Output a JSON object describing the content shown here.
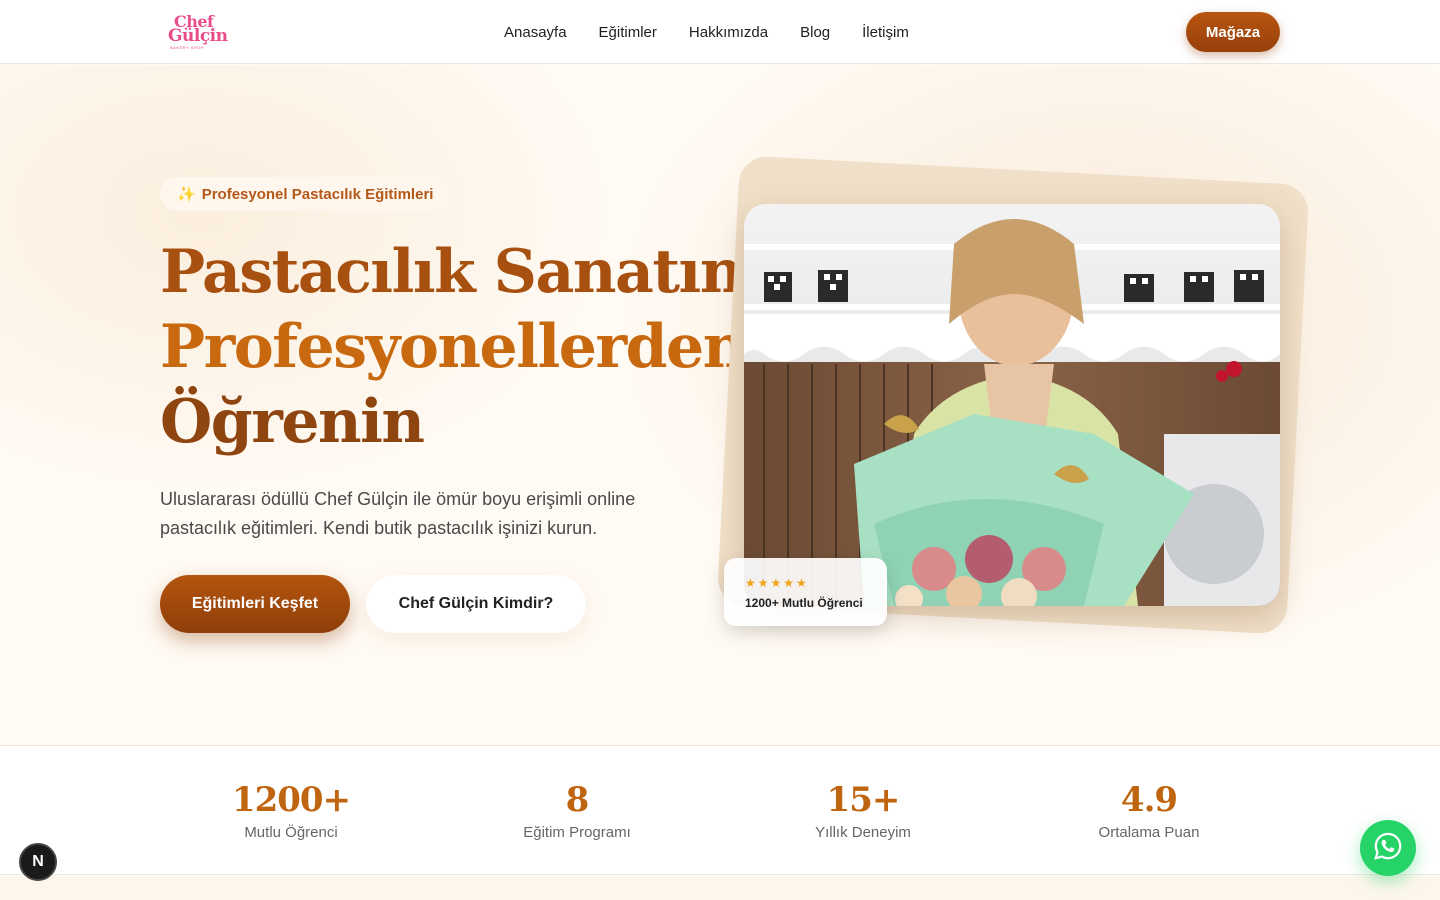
{
  "header": {
    "logo": {
      "line1": "Chef",
      "line2": "Gülçin",
      "line3": "BAKERY SHOP"
    },
    "nav": [
      "Anasayfa",
      "Eğitimler",
      "Hakkımızda",
      "Blog",
      "İletişim"
    ],
    "shop_label": "Mağaza"
  },
  "hero": {
    "badge_icon": "sparkles-icon",
    "badge": "Profesyonel Pastacılık Eğitimleri",
    "title_line1": "Pastacılık Sanatını",
    "title_line2": "Profesyonellerden",
    "title_line3": "Öğrenin",
    "lead": "Uluslararası ödüllü Chef Gülçin ile ömür boyu erişimli online pastacılık eğitimleri. Kendi butik pastacılık işinizi kurun.",
    "primary_cta": "Eğitimleri Keşfet",
    "secondary_cta": "Chef Gülçin Kimdir?",
    "rating_stars": "★★★★★",
    "rating_text": "1200+ Mutlu Öğrenci",
    "colors": {
      "brand": "#a8500f",
      "accent": "#c8690f",
      "dark": "#8e4510"
    }
  },
  "stats": [
    {
      "value": "1200+",
      "label": "Mutlu Öğrenci"
    },
    {
      "value": "8",
      "label": "Eğitim Programı"
    },
    {
      "value": "15+",
      "label": "Yıllık Deneyim"
    },
    {
      "value": "4.9",
      "label": "Ortalama Puan"
    }
  ],
  "floating": {
    "nextjs_letter": "N",
    "whatsapp_icon": "whatsapp-icon"
  }
}
